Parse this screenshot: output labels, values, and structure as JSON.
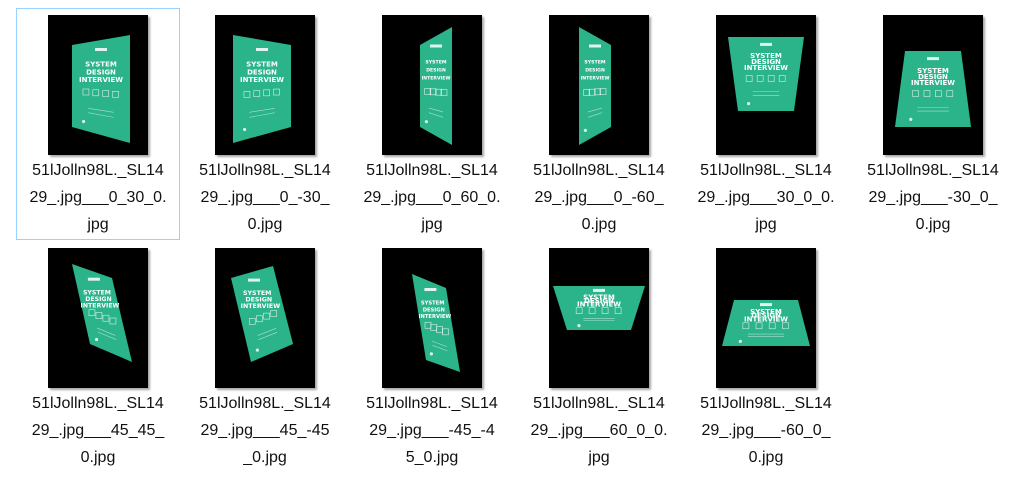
{
  "colors": {
    "cover_green": "#2bb38a",
    "cover_text": "#ffffff",
    "thumb_bg": "#000000",
    "selection_border": "#99d1ff"
  },
  "cover": {
    "volume": "VOLUME 2",
    "title_lines": [
      "SYSTEM",
      "DESIGN",
      "INTERVIEW"
    ]
  },
  "files": [
    {
      "name_lines": [
        "51lJolln98L._SL14",
        "29_.jpg___0_30_0.",
        "jpg"
      ],
      "selected": true,
      "warp": "tilt-left"
    },
    {
      "name_lines": [
        "51lJolln98L._SL14",
        "29_.jpg___0_-30_",
        "0.jpg"
      ],
      "selected": false,
      "warp": "tilt-right"
    },
    {
      "name_lines": [
        "51lJolln98L._SL14",
        "29_.jpg___0_60_0.",
        "jpg"
      ],
      "selected": false,
      "warp": "narrow-left"
    },
    {
      "name_lines": [
        "51lJolln98L._SL14",
        "29_.jpg___0_-60_",
        "0.jpg"
      ],
      "selected": false,
      "warp": "narrow-right"
    },
    {
      "name_lines": [
        "51lJolln98L._SL14",
        "29_.jpg___30_0_0.",
        "jpg"
      ],
      "selected": false,
      "warp": "top-wide"
    },
    {
      "name_lines": [
        "51lJolln98L._SL14",
        "29_.jpg___-30_0_",
        "0.jpg"
      ],
      "selected": false,
      "warp": "bottom-wide"
    },
    {
      "name_lines": [
        "51lJolln98L._SL14",
        "29_.jpg___45_45_",
        "0.jpg"
      ],
      "selected": false,
      "warp": "skew-a"
    },
    {
      "name_lines": [
        "51lJolln98L._SL14",
        "29_.jpg___45_-45",
        "_0.jpg"
      ],
      "selected": false,
      "warp": "skew-b"
    },
    {
      "name_lines": [
        "51lJolln98L._SL14",
        "29_.jpg___-45_-4",
        "5_0.jpg"
      ],
      "selected": false,
      "warp": "skew-c"
    },
    {
      "name_lines": [
        "51lJolln98L._SL14",
        "29_.jpg___60_0_0.",
        "jpg"
      ],
      "selected": false,
      "warp": "flat-top"
    },
    {
      "name_lines": [
        "51lJolln98L._SL14",
        "29_.jpg___-60_0_",
        "0.jpg"
      ],
      "selected": false,
      "warp": "flat-bottom"
    }
  ]
}
